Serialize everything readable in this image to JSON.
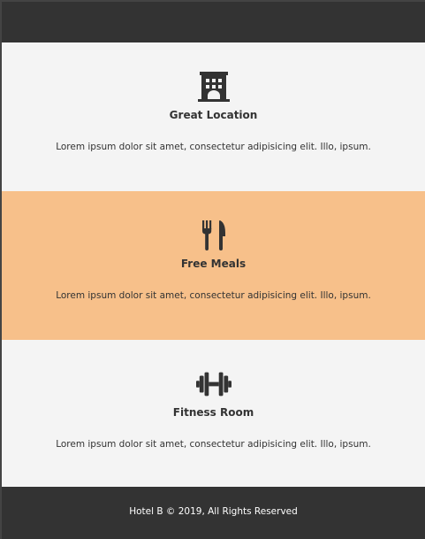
{
  "features": [
    {
      "icon": "hotel-icon",
      "title": "Great Location",
      "text": "Lorem ipsum dolor sit amet, consectetur adipisicing elit. Illo, ipsum."
    },
    {
      "icon": "utensils-icon",
      "title": "Free Meals",
      "text": "Lorem ipsum dolor sit amet, consectetur adipisicing elit. Illo, ipsum."
    },
    {
      "icon": "dumbbell-icon",
      "title": "Fitness Room",
      "text": "Lorem ipsum dolor sit amet, consectetur adipisicing elit. Illo, ipsum."
    }
  ],
  "footer": {
    "text": "Hotel B © 2019, All Rights Reserved"
  },
  "colors": {
    "dark": "#333333",
    "accent": "#f7c08a",
    "light": "#f4f4f4"
  }
}
